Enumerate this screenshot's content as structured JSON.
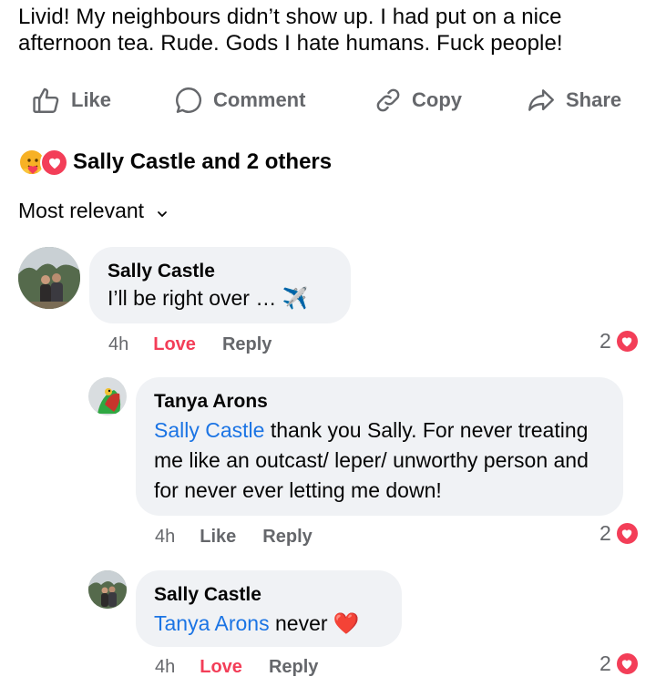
{
  "post": {
    "text": "Livid! My neighbours didn’t show up.  I had put on a  nice afternoon tea.  Rude.  Gods I hate humans.  Fuck people!"
  },
  "actions": {
    "like": "Like",
    "comment": "Comment",
    "copy": "Copy",
    "share": "Share"
  },
  "reactions": {
    "summary": "Sally Castle and 2 others",
    "icons": [
      "care-emoji",
      "love-heart"
    ]
  },
  "sort": {
    "label": "Most relevant"
  },
  "comments": [
    {
      "author": "Sally Castle",
      "text": "I’ll be right over …",
      "emoji": "✈️",
      "time": "4h",
      "reaction_label": "Love",
      "reply_label": "Reply",
      "reaction_count": "2"
    },
    {
      "author": "Tanya Arons",
      "mention": "Sally Castle",
      "text": " thank you Sally.  For never treating me like an outcast/ leper/ unworthy person and for never ever letting me down!",
      "time": "4h",
      "reaction_label": "Like",
      "reply_label": "Reply",
      "reaction_count": "2"
    },
    {
      "author": "Sally Castle",
      "mention": "Tanya Arons",
      "text": " never",
      "emoji": "❤️",
      "time": "4h",
      "reaction_label": "Love",
      "reply_label": "Reply",
      "reaction_count": "2"
    }
  ],
  "colors": {
    "love": "#f33e58",
    "mention": "#1b74e4",
    "muted": "#65676b",
    "bubble": "#f0f2f5"
  }
}
